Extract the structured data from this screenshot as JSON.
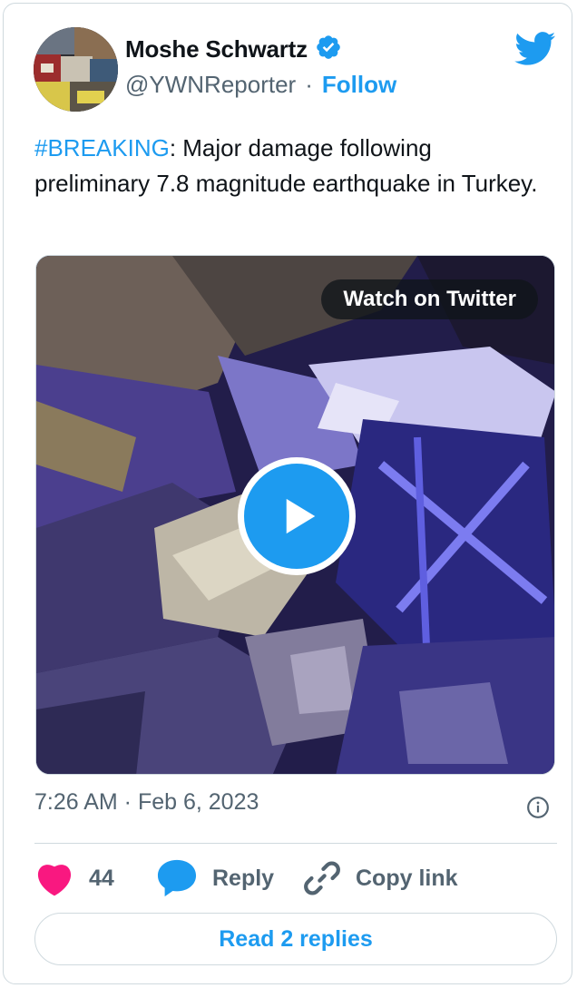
{
  "author": {
    "name": "Moshe Schwartz",
    "handle": "@YWNReporter",
    "separator": "·",
    "follow_label": "Follow",
    "verified": true
  },
  "tweet": {
    "hashtag": "#BREAKING",
    "text": ": Major damage following preliminary 7.8 magnitude earthquake in Turkey."
  },
  "media": {
    "watch_label": "Watch on Twitter",
    "type": "video"
  },
  "meta": {
    "timestamp": "7:26 AM · Feb 6, 2023"
  },
  "actions": {
    "like_count": "44",
    "reply_label": "Reply",
    "copy_label": "Copy link"
  },
  "read_replies_label": "Read 2 replies",
  "colors": {
    "accent": "#1d9bf0",
    "like": "#f91880",
    "text": "#0f1419",
    "muted": "#536471",
    "border": "#cfd9de"
  },
  "icons": [
    "twitter-bird-icon",
    "verified-badge-icon",
    "play-icon",
    "info-icon",
    "heart-icon",
    "reply-bubble-icon",
    "link-icon"
  ]
}
